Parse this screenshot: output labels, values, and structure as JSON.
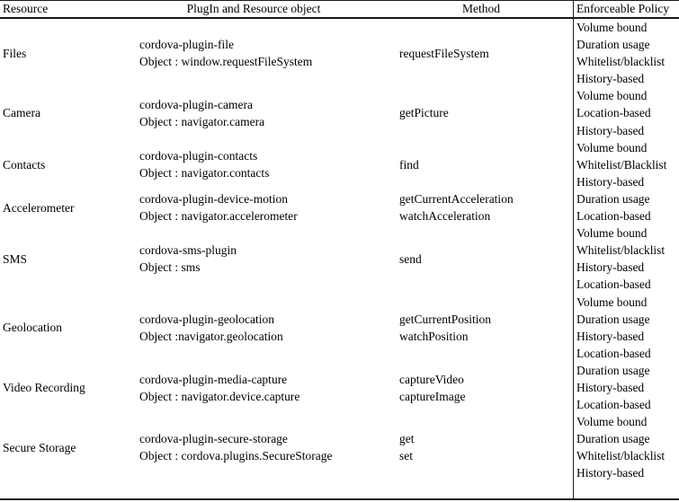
{
  "table": {
    "headers": {
      "resource": "Resource",
      "plugin": "PlugIn and Resource object",
      "method": "Method",
      "policy": "Enforceable Policy"
    },
    "rows": [
      {
        "resource": "Files",
        "plugin": "cordova-plugin-file",
        "object": "Object : window.requestFileSystem",
        "methods": [
          "requestFileSystem"
        ],
        "policies": [
          "Volume bound",
          "Duration usage",
          "Whitelist/blacklist",
          "History-based"
        ]
      },
      {
        "resource": "Camera",
        "plugin": "cordova-plugin-camera",
        "object": "Object : navigator.camera",
        "methods": [
          "getPicture"
        ],
        "policies": [
          "Volume bound",
          "Location-based",
          "History-based"
        ]
      },
      {
        "resource": "Contacts",
        "plugin": "cordova-plugin-contacts",
        "object": "Object : navigator.contacts",
        "methods": [
          "find"
        ],
        "policies": [
          "Volume bound",
          "Whitelist/Blacklist",
          "History-based"
        ]
      },
      {
        "resource": "Accelerometer",
        "plugin": "cordova-plugin-device-motion",
        "object": "Object : navigator.accelerometer",
        "methods": [
          "getCurrentAcceleration",
          "watchAcceleration"
        ],
        "policies": [
          "Duration usage",
          "Location-based"
        ]
      },
      {
        "resource": "SMS",
        "plugin": "cordova-sms-plugin",
        "object": "Object : sms",
        "methods": [
          "send"
        ],
        "policies": [
          "Volume bound",
          "Whitelist/blacklist",
          "History-based",
          "Location-based"
        ]
      },
      {
        "resource": "Geolocation",
        "plugin": "cordova-plugin-geolocation",
        "object": "Object :navigator.geolocation",
        "methods": [
          "getCurrentPosition",
          "watchPosition"
        ],
        "policies": [
          "Volume bound",
          "Duration usage",
          "History-based",
          "Location-based"
        ]
      },
      {
        "resource": "Video Recording",
        "plugin": "cordova-plugin-media-capture",
        "object": "Object : navigator.device.capture",
        "methods": [
          "captureVideo",
          "captureImage"
        ],
        "policies": [
          "Duration usage",
          "History-based",
          "Location-based"
        ]
      },
      {
        "resource": "Secure Storage",
        "plugin": "cordova-plugin-secure-storage",
        "object": "Object : cordova.plugins.SecureStorage",
        "methods": [
          "get",
          "set"
        ],
        "policies": [
          "Volume bound",
          "Duration usage",
          "Whitelist/blacklist",
          "History-based"
        ]
      }
    ]
  }
}
